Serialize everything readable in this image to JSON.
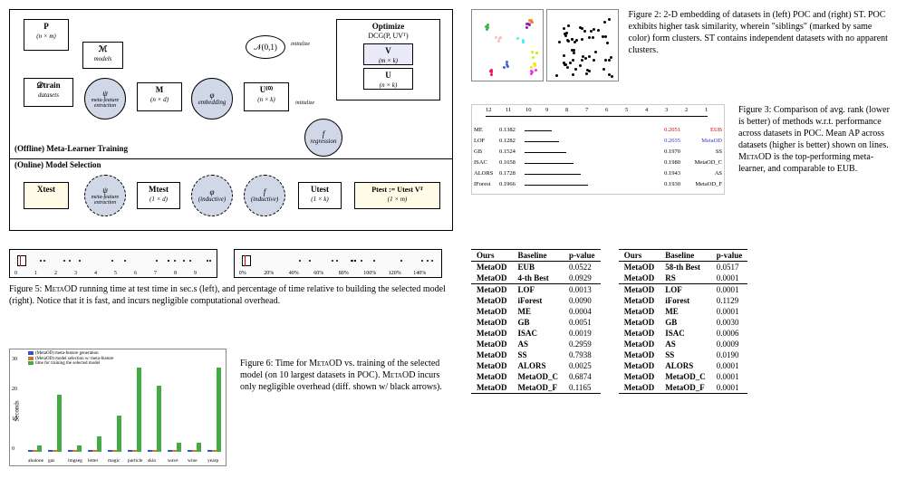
{
  "fig1": {
    "offline_label": "(Offline) Meta-Learner Training",
    "online_label": "(Online) Model Selection",
    "P": "P",
    "P_dim": "(n × m)",
    "Dtrain": "𝒟train",
    "Dtrain_sub": "datasets",
    "Mmodels": "ℳ",
    "Mmodels_sub": "models",
    "psi": "ψ",
    "psi_sub": "meta-feature\nextraction",
    "M": "M",
    "M_dim": "(n × d)",
    "phi": "φ",
    "phi_sub": "embedding",
    "U0": "U⁽⁰⁾",
    "U0_dim": "(n × k)",
    "N01": "𝒩(0,1)",
    "init": "initialize",
    "init2": "initialize",
    "opt_title": "Optimize",
    "opt_sub": "DCG(P, UVᵀ)",
    "V": "V",
    "V_dim": "(m × k)",
    "U": "U",
    "U_dim": "(n × k)",
    "f": "f",
    "f_sub": "regression",
    "Xtest": "Xtest",
    "psi2": "ψ",
    "psi2_sub": "meta-feature\nextraction",
    "Mtest": "Mtest",
    "Mtest_dim": "(1 × d)",
    "phi2": "φ",
    "phi2_sub": "(inductive)",
    "f2": "f",
    "f2_sub": "(inductive)",
    "Utest": "Utest",
    "Utest_dim": "(1 × k)",
    "Ptest": "Ptest := Utest Vᵀ",
    "Ptest_dim": "(1 × m)"
  },
  "fig2": {
    "caption": "Figure 2: 2-D embedding of datasets in (left) POC and (right) ST. POC exhibits higher task similarity, wherein \"siblings\" (marked by same color) form clusters. ST contains independent datasets with no apparent clusters."
  },
  "fig3": {
    "caption_head": "Figure 3: Comparison of avg. rank (lower is better) of methods w.r.t. performance across datasets in POC. Mean AP across datasets (higher is better) shown on lines. M",
    "caption_tail": " is the top-performing meta-learner, and comparable to EUB.",
    "sc": "etaOD",
    "ticks": [
      "12",
      "11",
      "10",
      "9",
      "8",
      "7",
      "6",
      "5",
      "4",
      "3",
      "2",
      "1"
    ],
    "left_labels": [
      "ME",
      "LOF",
      "GB",
      "ISAC",
      "ALORS",
      "IForest"
    ],
    "left_vals": [
      "0.1382",
      "0.1282",
      "0.1524",
      "0.1658",
      "0.1728",
      "0.1966"
    ],
    "right_labels": [
      "EUB",
      "MetaOD",
      "SS",
      "MetaOD_C",
      "AS",
      "MetaOD_F"
    ],
    "right_vals": [
      "0.2051",
      "0.2035",
      "0.1970",
      "0.1980",
      "0.1943",
      "0.1930"
    ]
  },
  "fig5": {
    "caption_head": "Figure 5: M",
    "caption_tail": " running time at test time in sec.s (left), and percentage of time relative to building the selected model (right). Notice that it is fast, and incurs negligible computational overhead.",
    "sc": "etaOD",
    "xticks_left": [
      "0",
      "1",
      "2",
      "3",
      "4",
      "5",
      "6",
      "7",
      "8",
      "9"
    ],
    "xticks_right": [
      "0%",
      "20%",
      "40%",
      "60%",
      "80%",
      "100%",
      "120%",
      "140%"
    ]
  },
  "fig6": {
    "caption_head": "Figure 6: Time for M",
    "caption_mid": " vs. training of the selected model (on 10 largest datasets in POC). M",
    "caption_tail": " incurs only negligible overhead (diff. shown w/ black arrows).",
    "sc": "etaOD",
    "legend": [
      "(MetaOD) meta-feature generation",
      "(MetaOD) model selection w/ meta-feature",
      "time for training the selected model"
    ],
    "ylabel": "Seconds",
    "yticks": [
      "0",
      "10",
      "20",
      "30"
    ]
  },
  "chart_data": {
    "type": "bar",
    "categories": [
      "abalone",
      "gas",
      "imgseg",
      "letter",
      "magic",
      "particle",
      "skin",
      "wave",
      "wine",
      "yearp"
    ],
    "series": [
      {
        "name": "(MetaOD) meta-feature generation",
        "values": [
          0.5,
          0.5,
          0.5,
          0.5,
          0.5,
          0.5,
          0.5,
          0.5,
          0.5,
          0.5
        ]
      },
      {
        "name": "(MetaOD) model selection w/ meta-feature",
        "values": [
          0.5,
          0.5,
          0.5,
          0.5,
          0.5,
          0.5,
          0.5,
          0.5,
          0.5,
          0.5
        ]
      },
      {
        "name": "time for training the selected model",
        "values": [
          2,
          19,
          2,
          5,
          12,
          28,
          22,
          3,
          3,
          28
        ]
      }
    ],
    "ylabel": "Seconds",
    "ylim": [
      0,
      30
    ]
  },
  "table_left": {
    "headers": [
      "Ours",
      "Baseline",
      "p-value"
    ],
    "sections": [
      [
        [
          "MetaOD",
          "EUB",
          "0.0522"
        ],
        [
          "MetaOD",
          "4-th Best",
          "0.0929"
        ]
      ],
      [
        [
          "MetaOD",
          "LOF",
          "0.0013"
        ],
        [
          "MetaOD",
          "iForest",
          "0.0090"
        ],
        [
          "MetaOD",
          "ME",
          "0.0004"
        ],
        [
          "MetaOD",
          "GB",
          "0.0051"
        ],
        [
          "MetaOD",
          "ISAC",
          "0.0019"
        ],
        [
          "MetaOD",
          "AS",
          "0.2959"
        ],
        [
          "MetaOD",
          "SS",
          "0.7938"
        ],
        [
          "MetaOD",
          "ALORS",
          "0.0025"
        ],
        [
          "MetaOD",
          "MetaOD_C",
          "0.6874"
        ],
        [
          "MetaOD",
          "MetaOD_F",
          "0.1165"
        ]
      ]
    ]
  },
  "table_right": {
    "headers": [
      "Ours",
      "Baseline",
      "p-value"
    ],
    "sections": [
      [
        [
          "MetaOD",
          "58-th Best",
          "0.0517"
        ],
        [
          "MetaOD",
          "RS",
          "0.0001"
        ]
      ],
      [
        [
          "MetaOD",
          "LOF",
          "0.0001"
        ],
        [
          "MetaOD",
          "iForest",
          "0.1129"
        ],
        [
          "MetaOD",
          "ME",
          "0.0001"
        ],
        [
          "MetaOD",
          "GB",
          "0.0030"
        ],
        [
          "MetaOD",
          "ISAC",
          "0.0006"
        ],
        [
          "MetaOD",
          "AS",
          "0.0009"
        ],
        [
          "MetaOD",
          "SS",
          "0.0190"
        ],
        [
          "MetaOD",
          "ALORS",
          "0.0001"
        ],
        [
          "MetaOD",
          "MetaOD_C",
          "0.0001"
        ],
        [
          "MetaOD",
          "MetaOD_F",
          "0.0001"
        ]
      ]
    ]
  }
}
